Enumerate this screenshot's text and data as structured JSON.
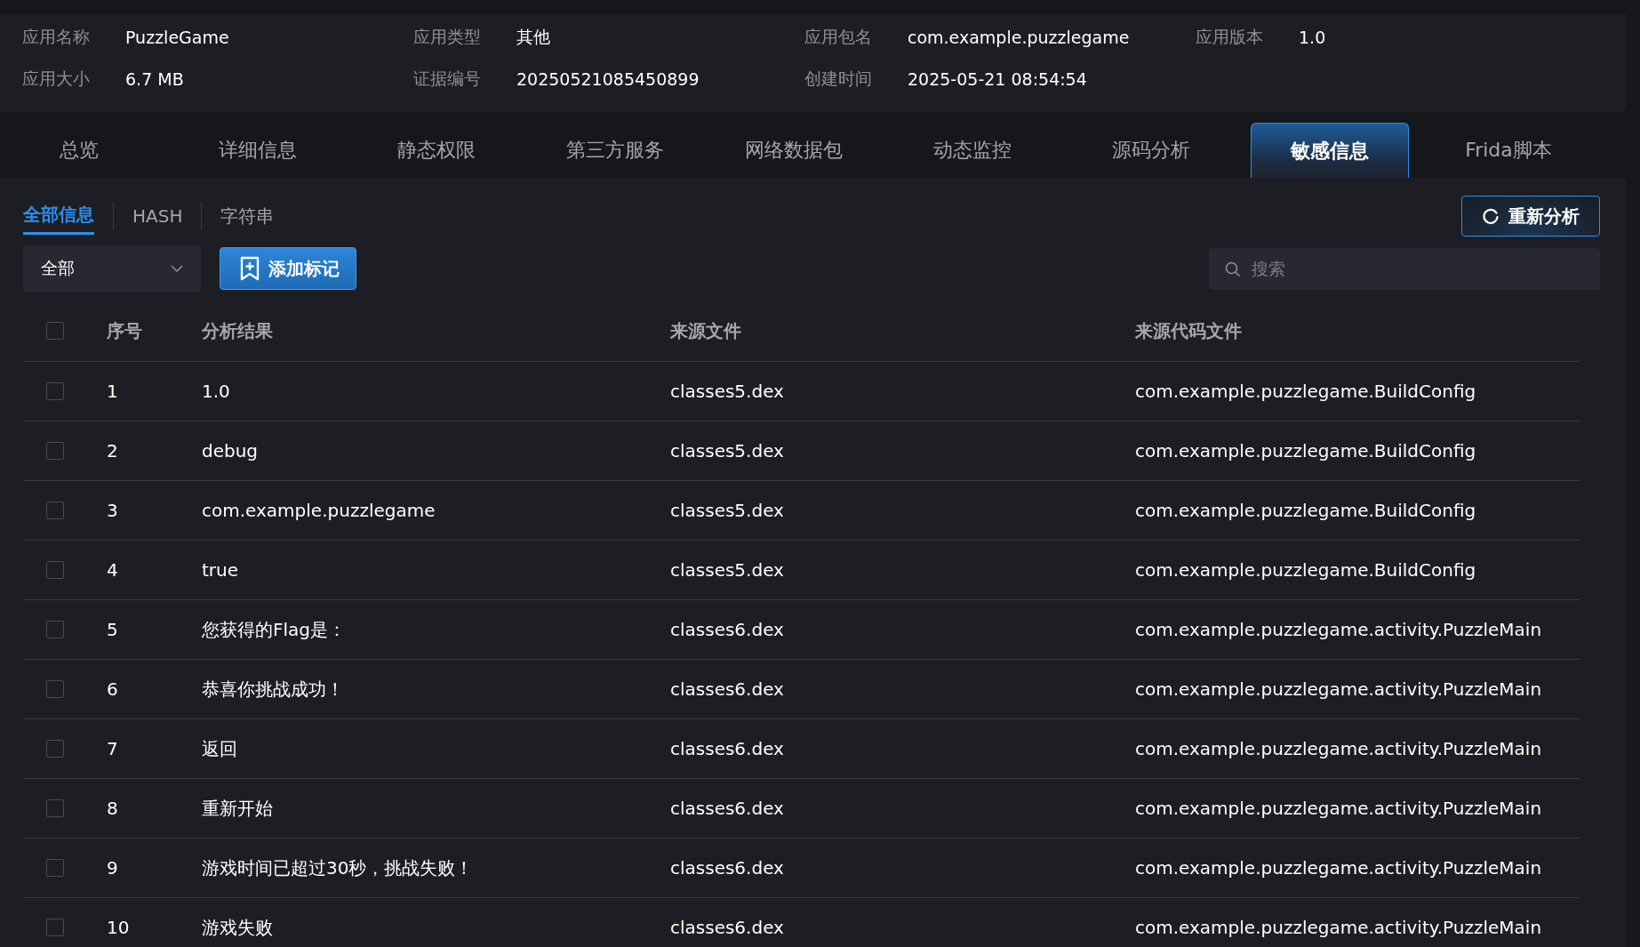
{
  "app_info": [
    {
      "label": "应用名称",
      "value": "PuzzleGame"
    },
    {
      "label": "应用类型",
      "value": "其他"
    },
    {
      "label": "应用包名",
      "value": "com.example.puzzlegame"
    },
    {
      "label": "应用版本",
      "value": "1.0"
    },
    {
      "label": "应用大小",
      "value": "6.7 MB"
    },
    {
      "label": "证据编号",
      "value": "20250521085450899"
    },
    {
      "label": "创建时间",
      "value": "2025-05-21 08:54:54"
    }
  ],
  "tabs": [
    {
      "label": "总览",
      "selected": false
    },
    {
      "label": "详细信息",
      "selected": false
    },
    {
      "label": "静态权限",
      "selected": false
    },
    {
      "label": "第三方服务",
      "selected": false
    },
    {
      "label": "网络数据包",
      "selected": false
    },
    {
      "label": "动态监控",
      "selected": false
    },
    {
      "label": "源码分析",
      "selected": false
    },
    {
      "label": "敏感信息",
      "selected": true
    },
    {
      "label": "Frida脚本",
      "selected": false
    }
  ],
  "sub_tabs": [
    {
      "label": "全部信息",
      "selected": true
    },
    {
      "label": "HASH",
      "selected": false
    },
    {
      "label": "字符串",
      "selected": false
    }
  ],
  "reanalyze_button": "重新分析",
  "filter_dropdown": {
    "value": "全部"
  },
  "add_mark_button": "添加标记",
  "search": {
    "placeholder": "搜索"
  },
  "table": {
    "header_checked": false,
    "columns": [
      "序号",
      "分析结果",
      "来源文件",
      "来源代码文件"
    ],
    "rows": [
      {
        "checked": false,
        "cells": [
          "1",
          "1.0",
          "classes5.dex",
          "com.example.puzzlegame.BuildConfig"
        ]
      },
      {
        "checked": false,
        "cells": [
          "2",
          "debug",
          "classes5.dex",
          "com.example.puzzlegame.BuildConfig"
        ]
      },
      {
        "checked": false,
        "cells": [
          "3",
          "com.example.puzzlegame",
          "classes5.dex",
          "com.example.puzzlegame.BuildConfig"
        ]
      },
      {
        "checked": false,
        "cells": [
          "4",
          "true",
          "classes5.dex",
          "com.example.puzzlegame.BuildConfig"
        ]
      },
      {
        "checked": false,
        "cells": [
          "5",
          "您获得的Flag是：",
          "classes6.dex",
          "com.example.puzzlegame.activity.PuzzleMain"
        ]
      },
      {
        "checked": false,
        "cells": [
          "6",
          "恭喜你挑战成功！",
          "classes6.dex",
          "com.example.puzzlegame.activity.PuzzleMain"
        ]
      },
      {
        "checked": false,
        "cells": [
          "7",
          "返回",
          "classes6.dex",
          "com.example.puzzlegame.activity.PuzzleMain"
        ]
      },
      {
        "checked": false,
        "cells": [
          "8",
          "重新开始",
          "classes6.dex",
          "com.example.puzzlegame.activity.PuzzleMain"
        ]
      },
      {
        "checked": false,
        "cells": [
          "9",
          "游戏时间已超过30秒，挑战失败！",
          "classes6.dex",
          "com.example.puzzlegame.activity.PuzzleMain"
        ]
      },
      {
        "checked": false,
        "cells": [
          "10",
          "游戏失败",
          "classes6.dex",
          "com.example.puzzlegame.activity.PuzzleMain"
        ]
      }
    ]
  }
}
